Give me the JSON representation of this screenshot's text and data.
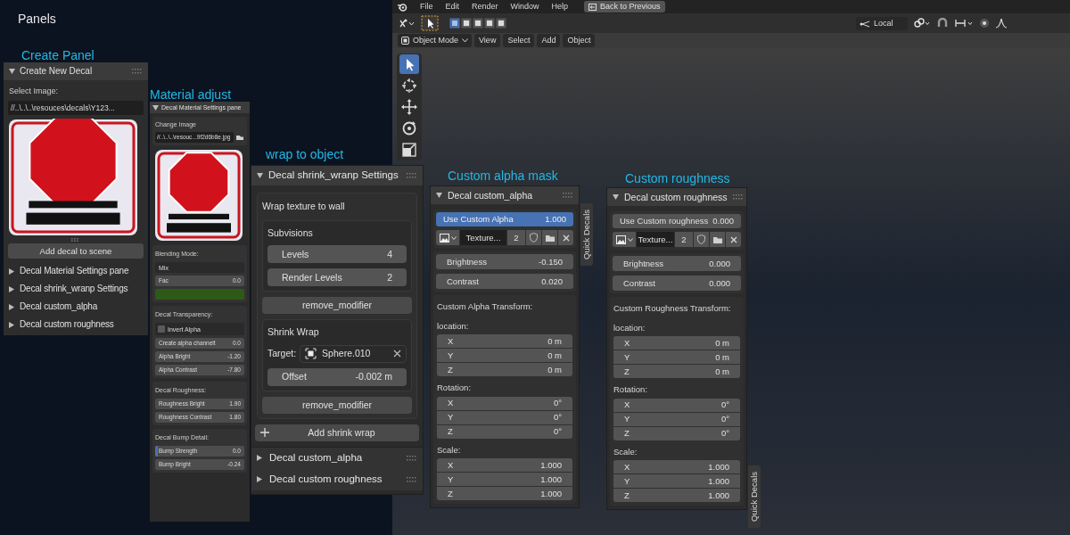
{
  "title": "Panels",
  "blender": {
    "menu": [
      "File",
      "Edit",
      "Render",
      "Window",
      "Help"
    ],
    "back_button": "Back to Previous",
    "select_modes": [
      {
        "selected": true
      },
      {
        "selected": false
      },
      {
        "selected": false
      },
      {
        "selected": false
      },
      {
        "selected": false
      }
    ],
    "orientation": "Local",
    "mode": "Object Mode",
    "header_menu": [
      "View",
      "Select",
      "Add",
      "Object"
    ],
    "tools": [
      {
        "kind": "select",
        "selected": true
      },
      {
        "kind": "cursor",
        "selected": false
      },
      {
        "kind": "move",
        "selected": false
      },
      {
        "kind": "rotate",
        "selected": false
      },
      {
        "kind": "scale",
        "selected": false
      }
    ]
  },
  "create_panel": {
    "caption": "Create Panel",
    "header": "Create New Decal",
    "select_label": "Select Image:",
    "path": "//..\\..\\..\\resouces\\decals\\Y123...",
    "add_button": "Add decal to scene",
    "collapsed": [
      "Decal Material Settings pane",
      "Decal shrink_wranp Settings",
      "Decal custom_alpha",
      "Decal custom roughness"
    ]
  },
  "material_panel": {
    "caption": "Material adjust",
    "header": "Decal Material Settings pane",
    "change_label": "Change Image",
    "path": "//..\\..\\..\\resouc...9f2d6b8e.jpg",
    "sections": [
      {
        "title": "Blending Mode:",
        "rows": [
          {
            "kind": "dropdown",
            "label": "Mix"
          },
          {
            "kind": "field",
            "label": "Fac",
            "value": "0.0"
          },
          {
            "kind": "swatch"
          }
        ]
      },
      {
        "title": "Decal Transparency:",
        "rows": [
          {
            "kind": "checkbox",
            "label": "Invert Alpha",
            "checked": false
          },
          {
            "kind": "field",
            "label": "Create alpha channelt",
            "value": "0.0"
          },
          {
            "kind": "field",
            "label": "Alpha Bright",
            "value": "-1.20"
          },
          {
            "kind": "field",
            "label": "Alpha Contrast",
            "value": "-7.80"
          }
        ]
      },
      {
        "title": "Decal Roughness:",
        "rows": [
          {
            "kind": "field",
            "label": "Roughness Bright",
            "value": "1.90"
          },
          {
            "kind": "field",
            "label": "Roughness  Contrast",
            "value": "1.80"
          }
        ]
      },
      {
        "title": "Decal Bump Detail:",
        "rows": [
          {
            "kind": "slider",
            "label": "Bump Strength",
            "value": "0.0",
            "level": 0.03
          },
          {
            "kind": "field",
            "label": "Bump Bright",
            "value": "-0.24"
          }
        ]
      }
    ]
  },
  "wrap_panel": {
    "caption": "wrap to object",
    "header": "Decal shrink_wranp Settings",
    "box_title": "Wrap texture to wall",
    "subdivisions": {
      "title": "Subvisions",
      "fields": [
        {
          "label": "Levels",
          "value": "4"
        },
        {
          "label": "Render Levels",
          "value": "2"
        }
      ]
    },
    "remove_button_1": "remove_modifier",
    "shrink": {
      "title": "Shrink Wrap",
      "target_label": "Target:",
      "target": "Sphere.010",
      "offset_label": "Offset",
      "offset": "-0.002 m"
    },
    "remove_button_2": "remove_modifier",
    "add_button": "Add shrink wrap",
    "collapsed": [
      "Decal custom_alpha",
      "Decal custom roughness"
    ]
  },
  "custom_panels": [
    {
      "caption": "Custom alpha mask",
      "header": "Decal custom_alpha",
      "use_label": "Use Custom Alpha",
      "use_value": "1.000",
      "on": true,
      "texture": "Texture...",
      "users": "2",
      "adjust": [
        {
          "label": "Brightness",
          "value": "-0.150"
        },
        {
          "label": "Contrast",
          "value": "0.020"
        }
      ],
      "transform_title": "Custom Alpha Transform:",
      "groups": [
        {
          "title": "location:",
          "rows": [
            {
              "label": "X",
              "value": "0 m"
            },
            {
              "label": "Y",
              "value": "0 m"
            },
            {
              "label": "Z",
              "value": "0 m"
            }
          ]
        },
        {
          "title": "Rotation:",
          "rows": [
            {
              "label": "X",
              "value": "0°"
            },
            {
              "label": "Y",
              "value": "0°"
            },
            {
              "label": "Z",
              "value": "0°"
            }
          ]
        },
        {
          "title": "Scale:",
          "rows": [
            {
              "label": "X",
              "value": "1.000"
            },
            {
              "label": "Y",
              "value": "1.000"
            },
            {
              "label": "Z",
              "value": "1.000"
            }
          ]
        }
      ],
      "tab": "Quick Decals"
    },
    {
      "caption": "Custom roughness",
      "header": "Decal custom roughness",
      "use_label": "Use Custom roughness",
      "use_value": "0.000",
      "on": false,
      "texture": "Texture...",
      "users": "2",
      "adjust": [
        {
          "label": "Brightness",
          "value": "0.000"
        },
        {
          "label": "Contrast",
          "value": "0.000"
        }
      ],
      "transform_title": "Custom Roughness Transform:",
      "groups": [
        {
          "title": "location:",
          "rows": [
            {
              "label": "X",
              "value": "0 m"
            },
            {
              "label": "Y",
              "value": "0 m"
            },
            {
              "label": "Z",
              "value": "0 m"
            }
          ]
        },
        {
          "title": "Rotation:",
          "rows": [
            {
              "label": "X",
              "value": "0°"
            },
            {
              "label": "Y",
              "value": "0°"
            },
            {
              "label": "Z",
              "value": "0°"
            }
          ]
        },
        {
          "title": "Scale:",
          "rows": [
            {
              "label": "X",
              "value": "1.000"
            },
            {
              "label": "Y",
              "value": "1.000"
            },
            {
              "label": "Z",
              "value": "1.000"
            }
          ]
        }
      ],
      "tab": "Quick Decals"
    }
  ]
}
